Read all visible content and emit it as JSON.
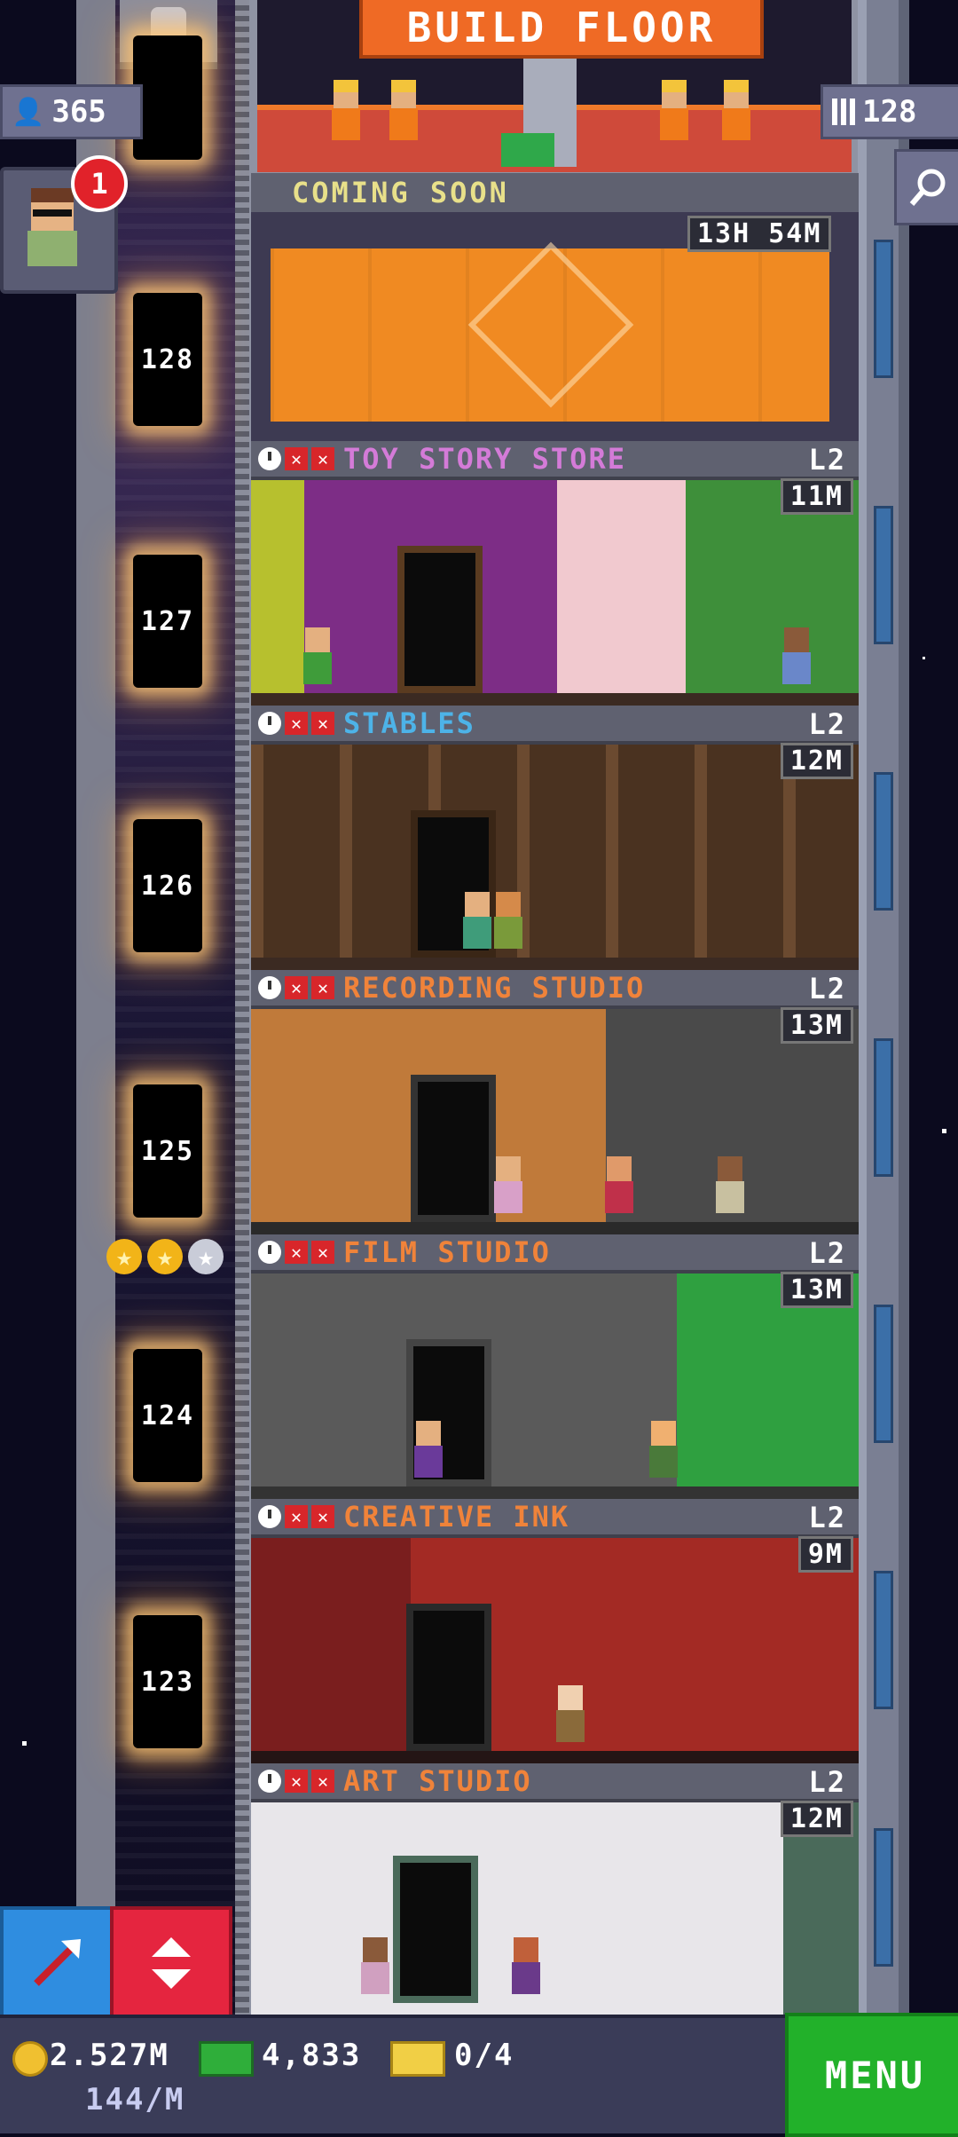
{
  "top": {
    "build_button_label": "BUILD FLOOR",
    "population": "365",
    "floor_count": "128",
    "notification_count": "1",
    "coming_soon_label": "COMING SOON",
    "construction_timer": "13H 54M"
  },
  "elevator": {
    "floor_numbers": [
      "128",
      "127",
      "126",
      "125",
      "124",
      "123"
    ],
    "star_rating": "2 of 3"
  },
  "floors": [
    {
      "name": "TOY STORY STORE",
      "level": "L2",
      "timer": "11M",
      "name_color": "#d47bd8"
    },
    {
      "name": "STABLES",
      "level": "L2",
      "timer": "12M",
      "name_color": "#4db3e8"
    },
    {
      "name": "RECORDING STUDIO",
      "level": "L2",
      "timer": "13M",
      "name_color": "#f0833a"
    },
    {
      "name": "FILM STUDIO",
      "level": "L2",
      "timer": "13M",
      "name_color": "#f0833a"
    },
    {
      "name": "CREATIVE INK",
      "level": "L2",
      "timer": "9M",
      "name_color": "#f0833a"
    },
    {
      "name": "ART STUDIO",
      "level": "L2",
      "timer": "12M",
      "name_color": "#f0833a"
    }
  ],
  "bottom": {
    "coins": "2.527M",
    "coin_rate": "144/M",
    "bux": "4,833",
    "tickets": "0/4",
    "menu_label": "MENU"
  },
  "colors": {
    "build_orange": "#ef6a25",
    "menu_green": "#22b12a",
    "alert_red": "#e1222a",
    "sky": "#0b0a1e"
  }
}
